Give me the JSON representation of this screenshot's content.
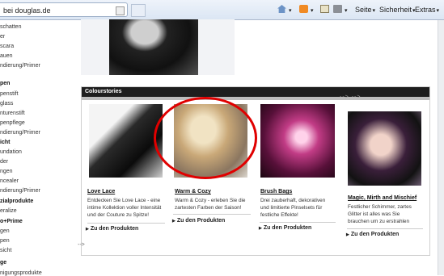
{
  "browser": {
    "tab_title": "bei douglas.de",
    "toolbar": {
      "seite": "Seite",
      "sicherheit": "Sicherheit",
      "extras": "Extras",
      "caret": "▾"
    }
  },
  "sidebar": {
    "items": [
      {
        "label": "schatten",
        "head": false
      },
      {
        "label": "er",
        "head": false
      },
      {
        "label": "scara",
        "head": false
      },
      {
        "label": "auen",
        "head": false
      },
      {
        "label": "ndierung/Primer",
        "head": false
      },
      {
        "label": "pen",
        "head": true
      },
      {
        "label": "penstift",
        "head": false
      },
      {
        "label": "glass",
        "head": false
      },
      {
        "label": "nturenstift",
        "head": false
      },
      {
        "label": "penpflege",
        "head": false
      },
      {
        "label": "ndierung/Primer",
        "head": false
      },
      {
        "label": "icht",
        "head": true
      },
      {
        "label": "undation",
        "head": false
      },
      {
        "label": "der",
        "head": false
      },
      {
        "label": "ngen",
        "head": false
      },
      {
        "label": "ncealer",
        "head": false
      },
      {
        "label": "ndierung/Primer",
        "head": false
      },
      {
        "label": "zialprodukte",
        "head": true
      },
      {
        "label": "eralize",
        "head": false
      },
      {
        "label": "o+Prime",
        "head": true
      },
      {
        "label": "gen",
        "head": false
      },
      {
        "label": "pen",
        "head": false
      },
      {
        "label": "sicht",
        "head": false
      },
      {
        "label": "ge",
        "head": true
      },
      {
        "label": "nigungsprodukte",
        "head": false
      }
    ]
  },
  "panel": {
    "title": "Colourstories",
    "arrows": "--> -->",
    "cards": [
      {
        "title": "Love Lace",
        "text": "Entdecken Sie Love Lace - eine intime Kollektion voller Intensität und der Couture zu Spitze!",
        "link": "Zu den Produkten",
        "arrow": "▶"
      },
      {
        "title": "Warm & Cozy",
        "text": "Warm & Cozy - erleben Sie die zartesten Farben der Saison!",
        "link": "Zu den Produkten",
        "arrow": "▶"
      },
      {
        "title": "Brush Bags",
        "text": "Drei zauberhaft, dekorativen und limitierte Pinselsets für festliche Effekte!",
        "link": "Zu den Produkten",
        "arrow": "▶"
      },
      {
        "title": "Magic, Mirth and Mischief",
        "text": "Festlicher Schimmer, zartes Glitter ist alles was Sie brauchen um zu erstrahlen",
        "link": "Zu den Produkten",
        "arrow": "▶"
      }
    ]
  },
  "bottom_arrow": "-->"
}
